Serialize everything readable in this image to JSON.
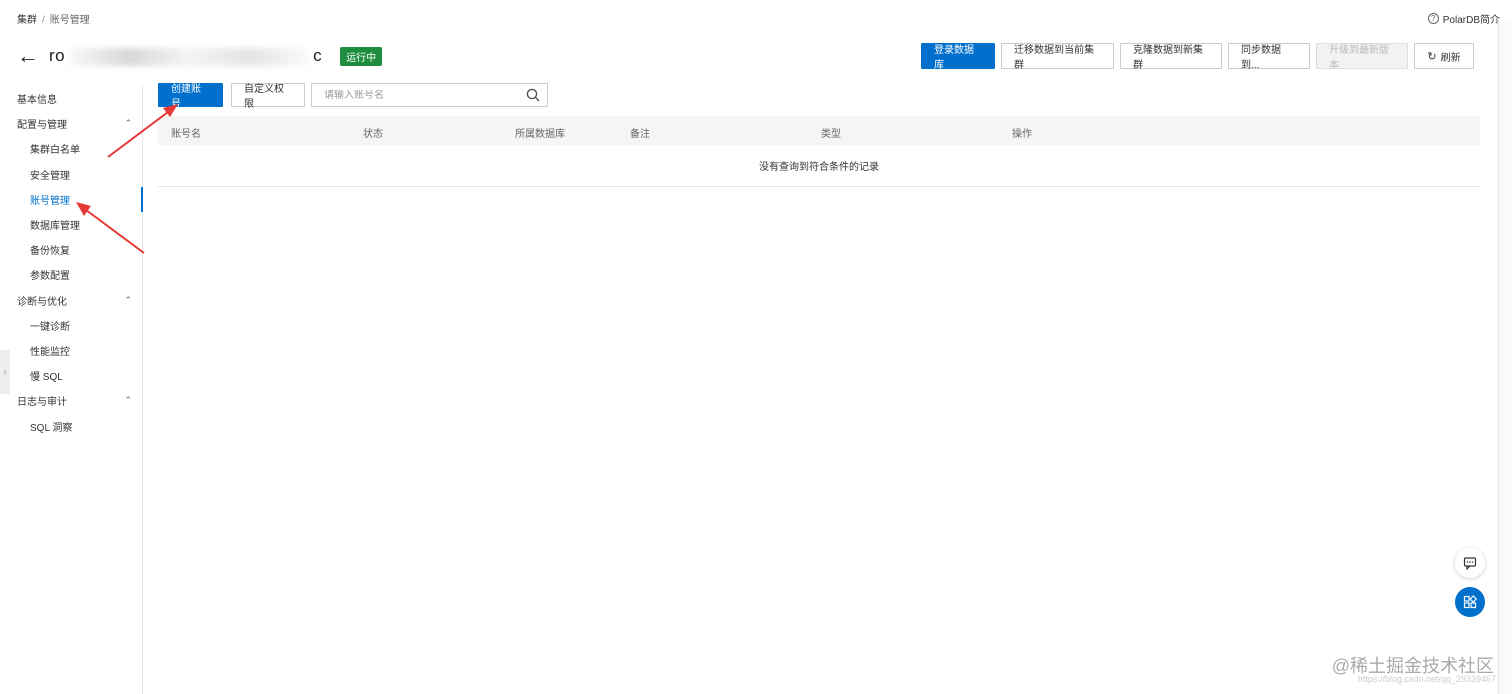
{
  "breadcrumb": {
    "root": "集群",
    "separator": "/",
    "current": "账号管理"
  },
  "polar_link": {
    "icon": "question-circle-icon",
    "label": "PolarDB简介"
  },
  "header": {
    "title_prefix": "ro",
    "title_fragment_1": "n",
    "title_suffix": "c",
    "status": "运行中",
    "status_color": "#1e8e3e"
  },
  "actions": {
    "login_db": "登录数据库",
    "migrate": "迁移数据到当前集群",
    "clone": "克隆数据到新集群",
    "sync": "同步数据到...",
    "upgrade": "升级到最新版本",
    "refresh": "刷新"
  },
  "sidebar": {
    "items": [
      {
        "label": "基本信息",
        "level": 1
      },
      {
        "label": "配置与管理",
        "level": 1,
        "group": true
      },
      {
        "label": "集群白名单",
        "level": 2
      },
      {
        "label": "安全管理",
        "level": 2
      },
      {
        "label": "账号管理",
        "level": 2,
        "active": true
      },
      {
        "label": "数据库管理",
        "level": 2
      },
      {
        "label": "备份恢复",
        "level": 2
      },
      {
        "label": "参数配置",
        "level": 2
      },
      {
        "label": "诊断与优化",
        "level": 1,
        "group": true
      },
      {
        "label": "一键诊断",
        "level": 2
      },
      {
        "label": "性能监控",
        "level": 2
      },
      {
        "label": "慢 SQL",
        "level": 2
      },
      {
        "label": "日志与审计",
        "level": 1,
        "group": true
      },
      {
        "label": "SQL 洞察",
        "level": 2
      }
    ]
  },
  "toolbar": {
    "create_account": "创建账号",
    "custom_permission": "自定义权限",
    "search_placeholder": "请输入账号名"
  },
  "table": {
    "columns": [
      "账号名",
      "状态",
      "所属数据库",
      "备注",
      "类型",
      "操作"
    ],
    "empty_text": "没有查询到符合条件的记录"
  },
  "watermark": {
    "text": "@稀土掘金技术社区",
    "url_fragment": "https://blog.csdn.net/qq_29339467"
  },
  "colors": {
    "primary": "#0070cc",
    "arrow": "#e53935"
  }
}
